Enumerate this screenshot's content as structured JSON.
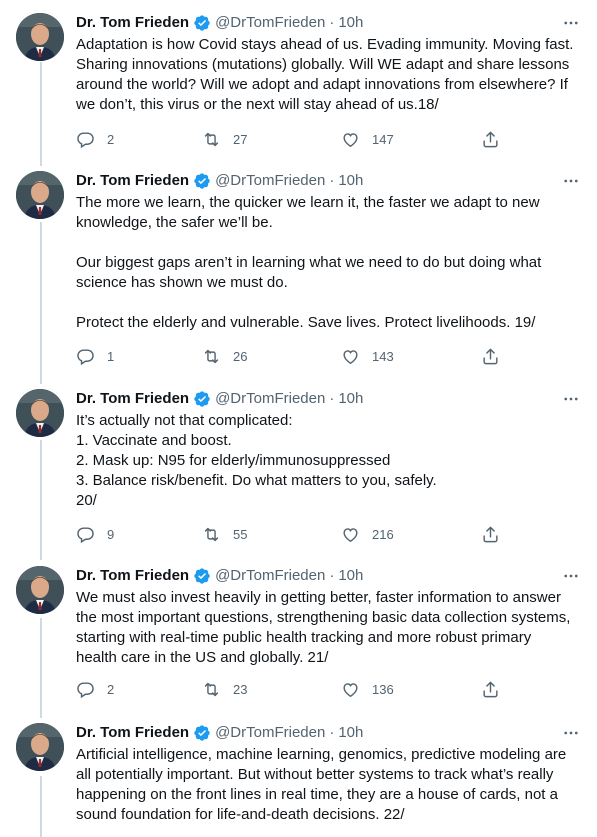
{
  "tweets": [
    {
      "author_name": "Dr. Tom Frieden",
      "handle": "@DrTomFrieden",
      "time": "10h",
      "paragraphs": [
        "Adaptation is how Covid stays ahead of us. Evading immunity. Moving fast. Sharing innovations (mutations) globally. Will WE adapt and share lessons around the world? Will we adopt and adapt innovations from elsewhere? If we don’t, this virus or the next will stay ahead of us.18/"
      ],
      "replies": "2",
      "retweets": "27",
      "likes": "147"
    },
    {
      "author_name": "Dr. Tom Frieden",
      "handle": "@DrTomFrieden",
      "time": "10h",
      "paragraphs": [
        "The more we learn, the quicker we learn it, the faster we adapt to new knowledge, the safer we’ll be.",
        "Our biggest gaps aren’t in learning what we need to do but doing what science has shown we must do.",
        "Protect the elderly and vulnerable. Save lives. Protect livelihoods. 19/"
      ],
      "replies": "1",
      "retweets": "26",
      "likes": "143"
    },
    {
      "author_name": "Dr. Tom Frieden",
      "handle": "@DrTomFrieden",
      "time": "10h",
      "lines": [
        "It’s actually not that complicated:",
        "1. Vaccinate and boost.",
        "2. Mask up: N95 for elderly/immunosuppressed",
        "3. Balance risk/benefit. Do what matters to you, safely.",
        "20/"
      ],
      "replies": "9",
      "retweets": "55",
      "likes": "216"
    },
    {
      "author_name": "Dr. Tom Frieden",
      "handle": "@DrTomFrieden",
      "time": "10h",
      "paragraphs": [
        "We must also invest heavily in getting better, faster information to answer the most important questions, strengthening basic data collection systems, starting with real-time public health tracking and more robust primary health care in the US and globally. 21/"
      ],
      "replies": "2",
      "retweets": "23",
      "likes": "136"
    },
    {
      "author_name": "Dr. Tom Frieden",
      "handle": "@DrTomFrieden",
      "time": "10h",
      "paragraphs": [
        "Artificial intelligence, machine learning, genomics, predictive modeling are all potentially important. But without better systems to track what’s really happening on the front lines in real time, they are a house of cards, not a sound foundation for life-and-death decisions. 22/"
      ]
    }
  ],
  "icons": {
    "verified": "verified-badge-icon",
    "more": "more-horizontal-icon",
    "reply": "reply-icon",
    "retweet": "retweet-icon",
    "like": "like-icon",
    "share": "share-icon"
  },
  "colors": {
    "text": "#0f1419",
    "secondary": "#536471",
    "verified": "#1d9bf0",
    "thread_line": "#cfd9de"
  }
}
